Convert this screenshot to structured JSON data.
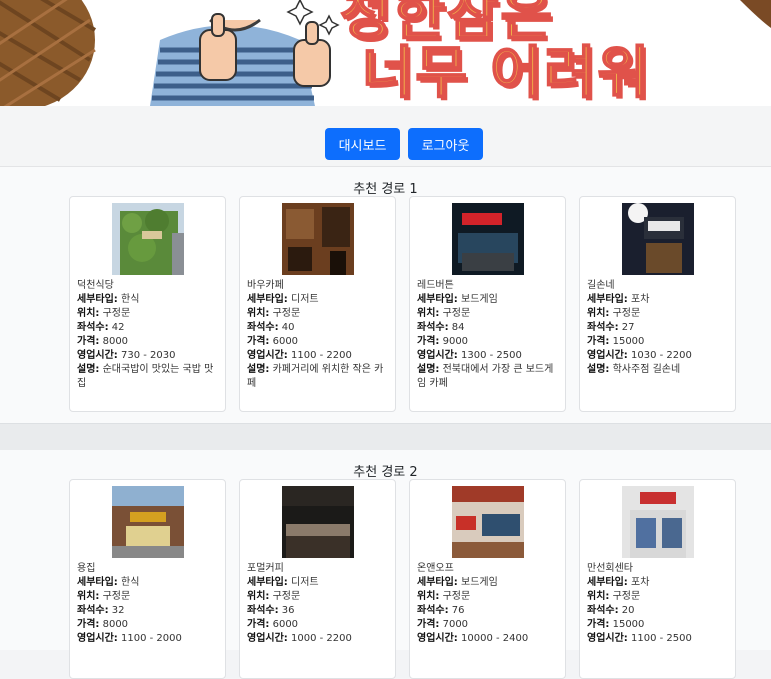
{
  "hero": {
    "line1": "청한잠은",
    "line2": "너무 어려워"
  },
  "nav": {
    "dashboard_label": "대시보드",
    "logout_label": "로그아웃"
  },
  "field_labels": {
    "type": "세부타입:",
    "location": "위치:",
    "seats": "좌석수:",
    "price": "가격:",
    "hours": "영업시간:",
    "desc": "설명:"
  },
  "routes": [
    {
      "title": "추천 경로 1",
      "places": [
        {
          "name": "덕천식당",
          "type": "한식",
          "location": "구정문",
          "seats": "42",
          "price": "8000",
          "hours": "730 - 2030",
          "desc": "순대국밥이 맛있는 국밥 맛집"
        },
        {
          "name": "바우카페",
          "type": "디저트",
          "location": "구정문",
          "seats": "40",
          "price": "6000",
          "hours": "1100 - 2200",
          "desc": "카페거리에 위치한 작은 카페"
        },
        {
          "name": "레드버튼",
          "type": "보드게임",
          "location": "구정문",
          "seats": "84",
          "price": "9000",
          "hours": "1300 - 2500",
          "desc": "전북대에서 가장 큰 보드게임 카페"
        },
        {
          "name": "길손네",
          "type": "포차",
          "location": "구정문",
          "seats": "27",
          "price": "15000",
          "hours": "1030 - 2200",
          "desc": "학사주점 길손네"
        }
      ]
    },
    {
      "title": "추천 경로 2",
      "places": [
        {
          "name": "용집",
          "type": "한식",
          "location": "구정문",
          "seats": "32",
          "price": "8000",
          "hours": "1100 - 2000",
          "desc": ""
        },
        {
          "name": "포멀커피",
          "type": "디저트",
          "location": "구정문",
          "seats": "36",
          "price": "6000",
          "hours": "1000 - 2200",
          "desc": ""
        },
        {
          "name": "온앤오프",
          "type": "보드게임",
          "location": "구정문",
          "seats": "76",
          "price": "7000",
          "hours": "10000 - 2400",
          "desc": ""
        },
        {
          "name": "만선회센타",
          "type": "포차",
          "location": "구정문",
          "seats": "20",
          "price": "15000",
          "hours": "1100 - 2500",
          "desc": ""
        }
      ]
    }
  ]
}
